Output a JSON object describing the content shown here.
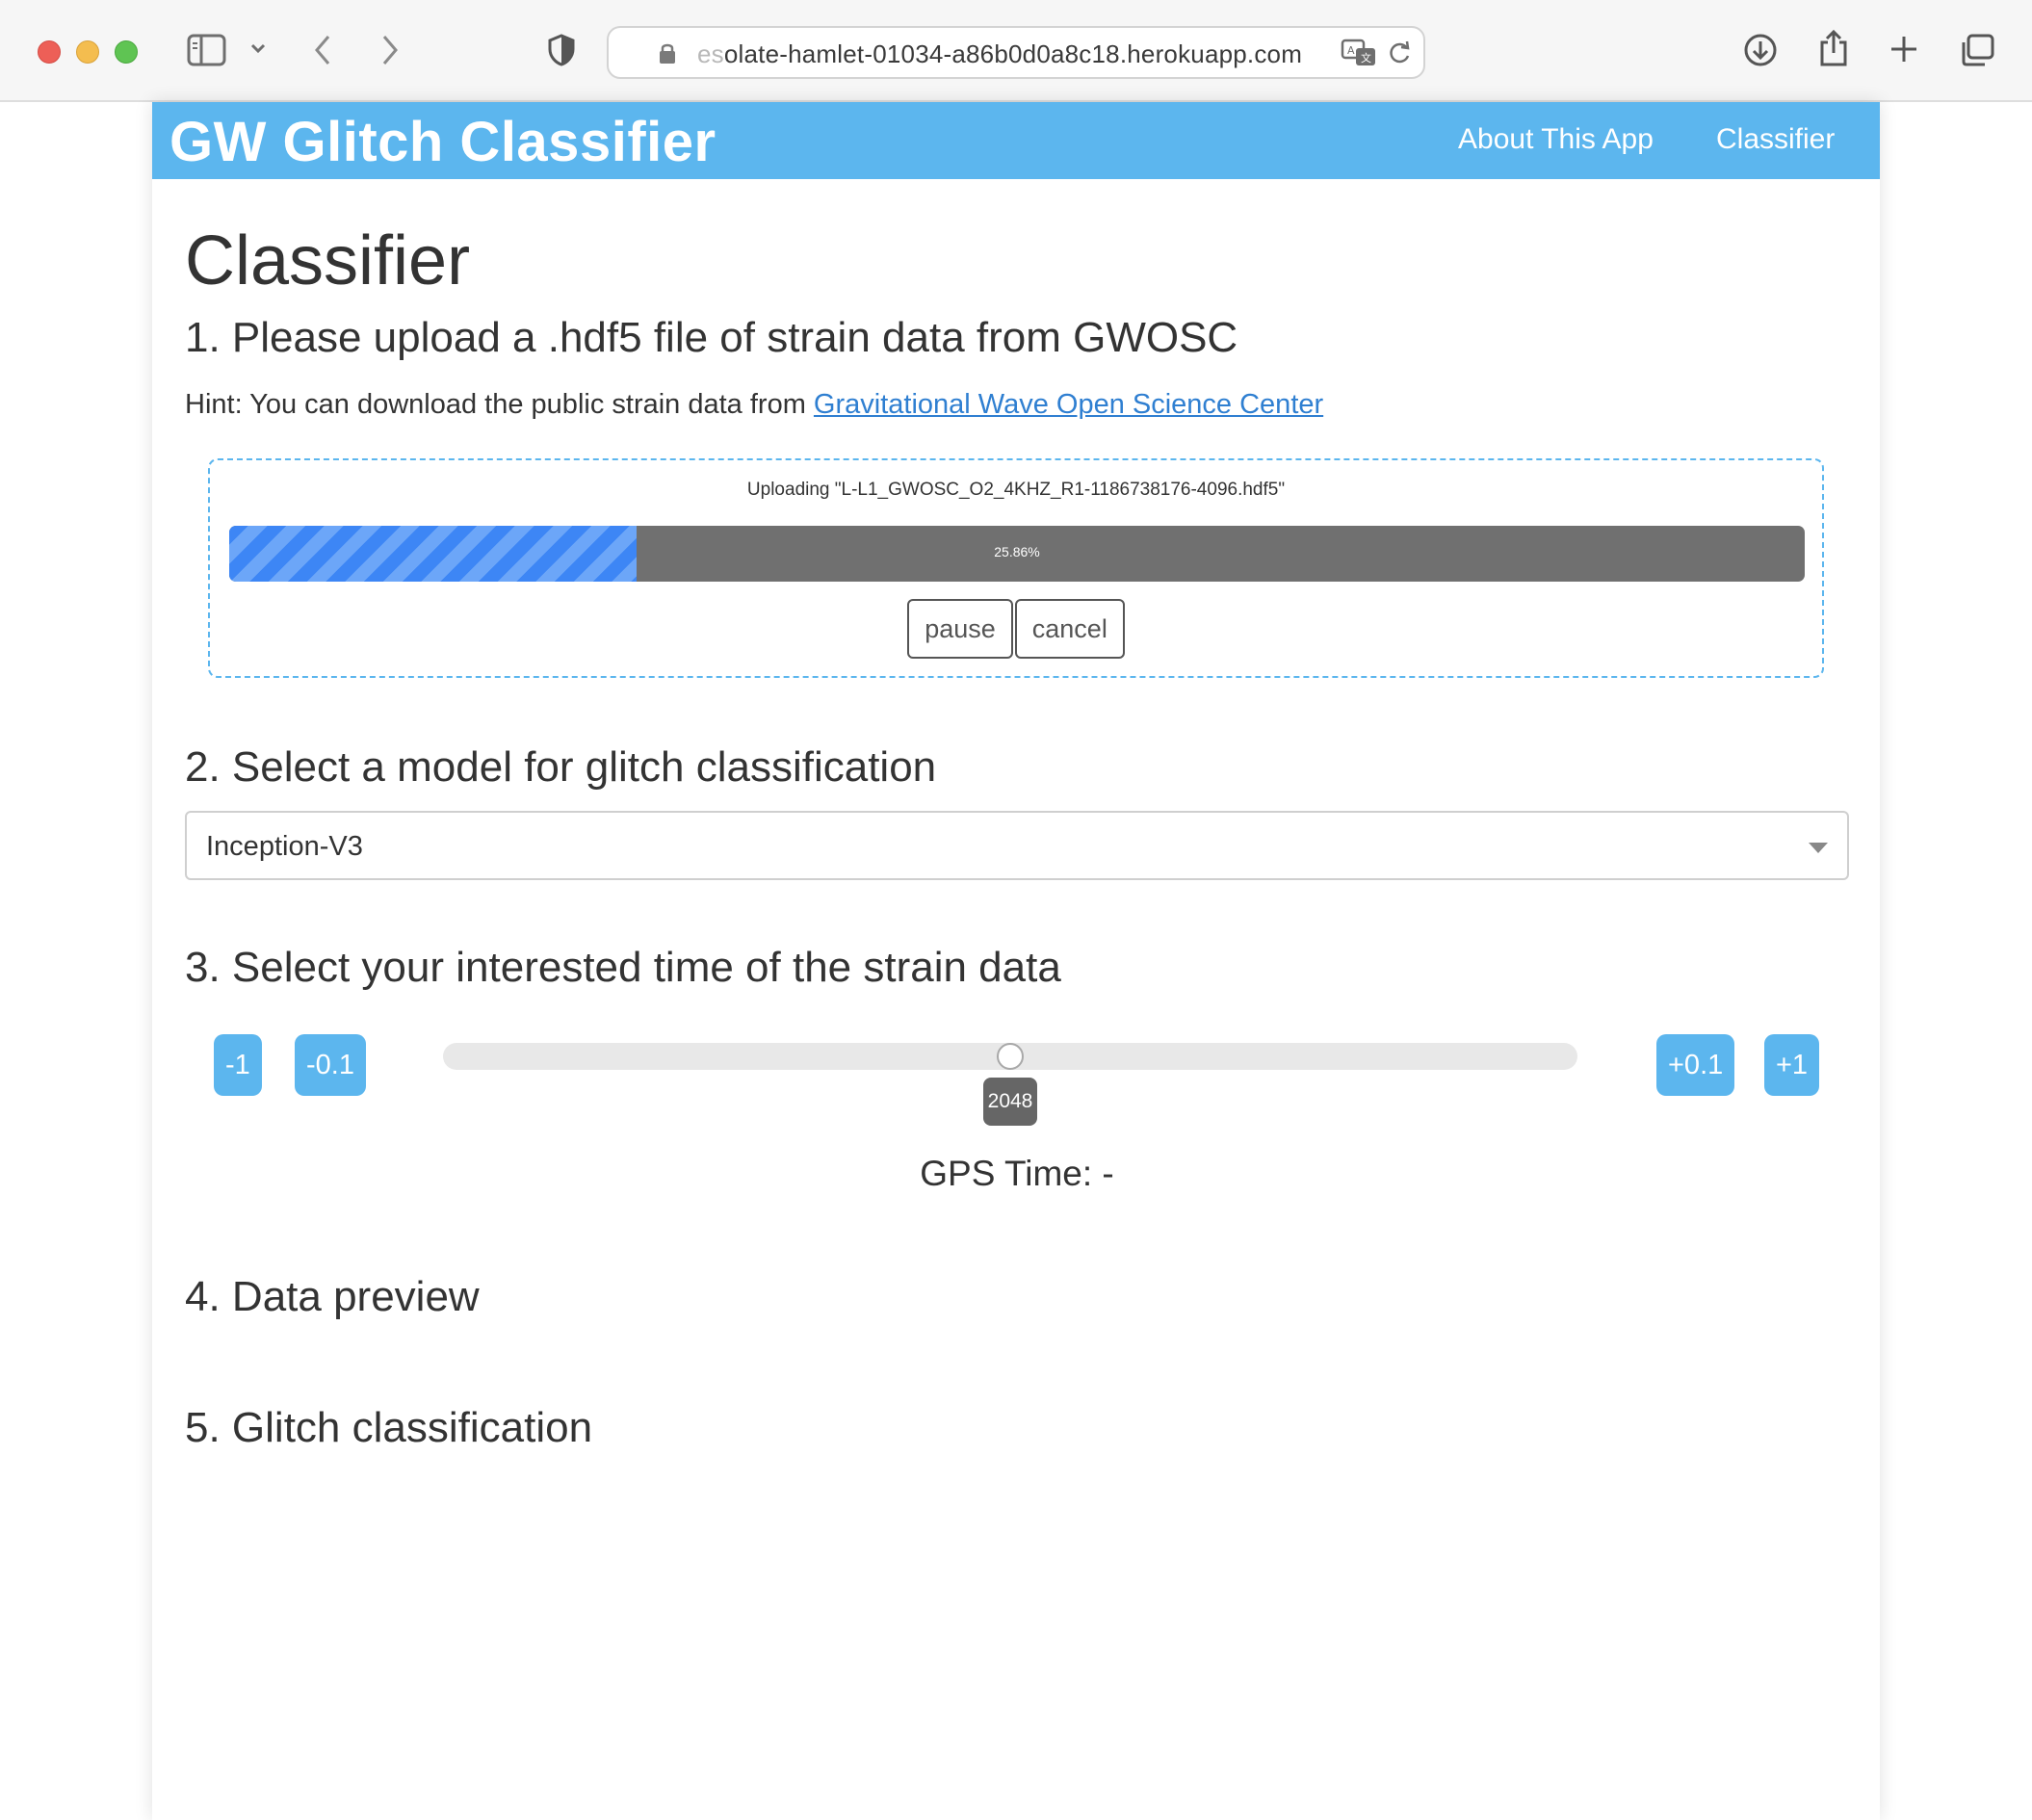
{
  "browser": {
    "url_faded_prefix": "es",
    "url_rest": "olate-hamlet-01034-a86b0d0a8c18.herokuapp.com"
  },
  "navbar": {
    "brand": "GW Glitch Classifier",
    "links": [
      "About This App",
      "Classifier"
    ]
  },
  "page": {
    "title": "Classifier",
    "step1": {
      "heading": "1. Please upload a .hdf5 file of strain data from GWOSC",
      "hint_prefix": "Hint: You can download the public strain data from ",
      "hint_link": "Gravitational Wave Open Science Center",
      "upload_label": "Uploading \"L-L1_GWOSC_O2_4KHZ_R1-1186738176-4096.hdf5\"",
      "progress_percent": 25.86,
      "progress_text": "25.86%",
      "pause_label": "pause",
      "cancel_label": "cancel"
    },
    "step2": {
      "heading": "2. Select a model for glitch classification",
      "selected_model": "Inception-V3"
    },
    "step3": {
      "heading": "3. Select your interested time of the strain data",
      "minus1": "-1",
      "minus01": "-0.1",
      "plus01": "+0.1",
      "plus1": "+1",
      "slider_value": "2048",
      "slider_min": 0,
      "slider_max": 4096,
      "gps_time": "GPS Time: -"
    },
    "step4": {
      "heading": "4. Data preview"
    },
    "step5": {
      "heading": "5. Glitch classification"
    }
  },
  "colors": {
    "accent": "#5cb6ee",
    "progress_fill": "#3d86f5",
    "progress_track": "#707070"
  }
}
